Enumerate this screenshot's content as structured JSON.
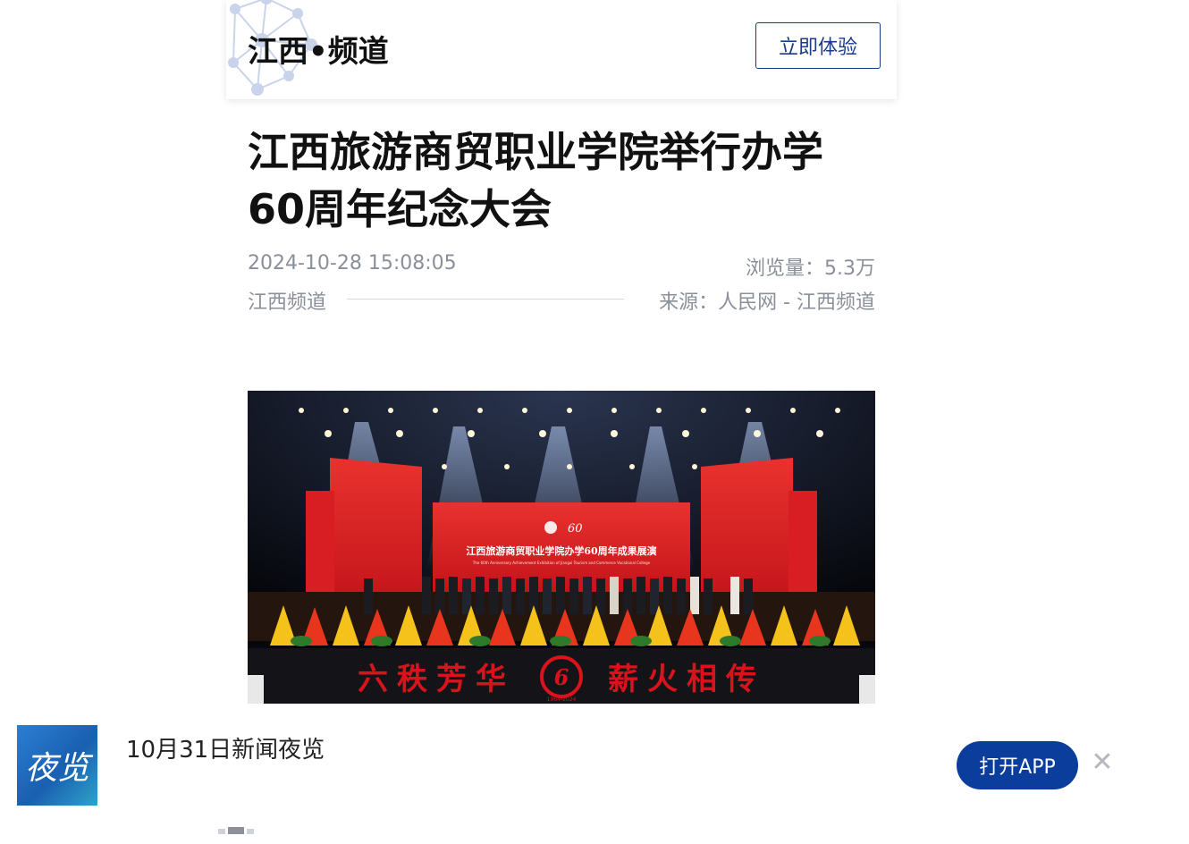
{
  "header": {
    "channel_name": "江西•频道",
    "try_button": "立即体验"
  },
  "article": {
    "title": "江西旅游商贸职业学院举行办学60周年纪念大会",
    "date": "2024-10-28 15:08:05",
    "views": "浏览量：5.3万",
    "channel": "江西频道",
    "source": "来源：人民网 - 江西频道"
  },
  "hero": {
    "screen_title": "江西旅游商贸职业学院办学60周年成果展演",
    "screen_subtitle": "The 60th Anniversary Achievement Exhibition of Jiangxi Tourism and Commerce Vocational College",
    "banner_left": "六秩芳华",
    "banner_right": "薪火相传",
    "emblem_years": "1964-2024"
  },
  "app_bar": {
    "logo_text": "夜览",
    "news_title": "10月31日新闻夜览",
    "open_app": "打开APP",
    "close_icon": "✕"
  },
  "colors": {
    "brand_blue": "#0a3d9c",
    "outline_blue": "#1a3a8a",
    "meta_gray": "#8a8f99",
    "stage_red": "#d8131b"
  }
}
